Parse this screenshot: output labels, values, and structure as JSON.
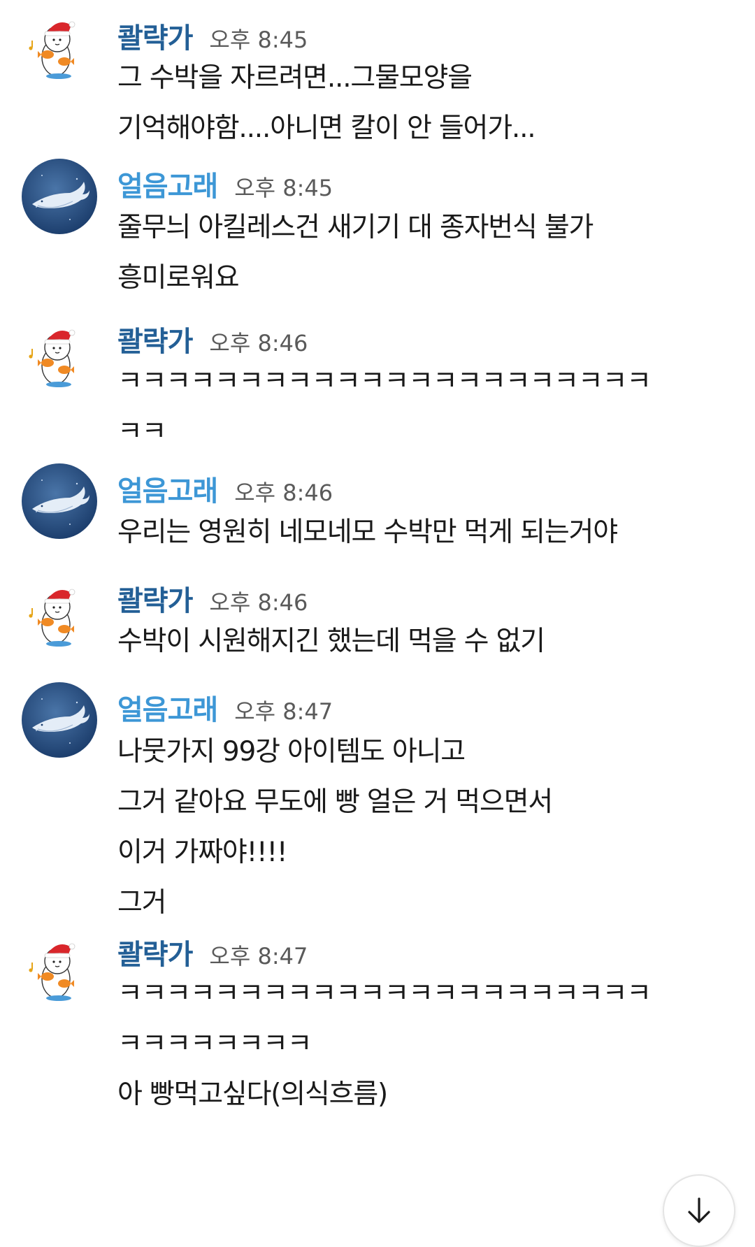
{
  "messages": [
    {
      "sender": "콸략가",
      "time": "오후 8:45",
      "avatar": "santa-character-avatar",
      "lines": [
        "그 수박을 자르려면...그물모양을",
        "기억해야함....아니면 칼이 안 들어가..."
      ]
    },
    {
      "sender": "얼음고래",
      "time": "오후 8:45",
      "avatar": "whale-avatar",
      "lines": [
        "줄무늬 아킬레스건 새기기 대 종자번식 불가",
        "흥미로워요"
      ]
    },
    {
      "sender": "콸략가",
      "time": "오후 8:46",
      "avatar": "santa-character-avatar",
      "lines": [
        "ㅋㅋㅋㅋㅋㅋㅋㅋㅋㅋㅋㅋㅋㅋㅋㅋㅋㅋㅋㅋㅋㅋ",
        "ㅋㅋ"
      ]
    },
    {
      "sender": "얼음고래",
      "time": "오후 8:46",
      "avatar": "whale-avatar",
      "lines": [
        "우리는 영원히 네모네모 수박만 먹게 되는거야"
      ]
    },
    {
      "sender": "콸략가",
      "time": "오후 8:46",
      "avatar": "santa-character-avatar",
      "lines": [
        "수박이 시원해지긴 했는데 먹을 수 없기"
      ]
    },
    {
      "sender": "얼음고래",
      "time": "오후 8:47",
      "avatar": "whale-avatar",
      "lines": [
        "나뭇가지 99강 아이템도 아니고",
        "그거 같아요 무도에 빵 얼은 거 먹으면서",
        "이거 가짜야!!!!",
        "그거"
      ]
    },
    {
      "sender": "콸략가",
      "time": "오후 8:47",
      "avatar": "santa-character-avatar",
      "lines": [
        "ㅋㅋㅋㅋㅋㅋㅋㅋㅋㅋㅋㅋㅋㅋㅋㅋㅋㅋㅋㅋㅋㅋ",
        "ㅋㅋㅋㅋㅋㅋㅋㅋ",
        "아 빵먹고싶다(의식흐름)"
      ]
    }
  ],
  "scroll_button": {
    "icon": "arrow-down-icon"
  },
  "colors": {
    "name_kwalyakga": "#235f96",
    "name_whale": "#3d97d6",
    "time": "#5a5a5a",
    "text": "#1a1a1a"
  }
}
